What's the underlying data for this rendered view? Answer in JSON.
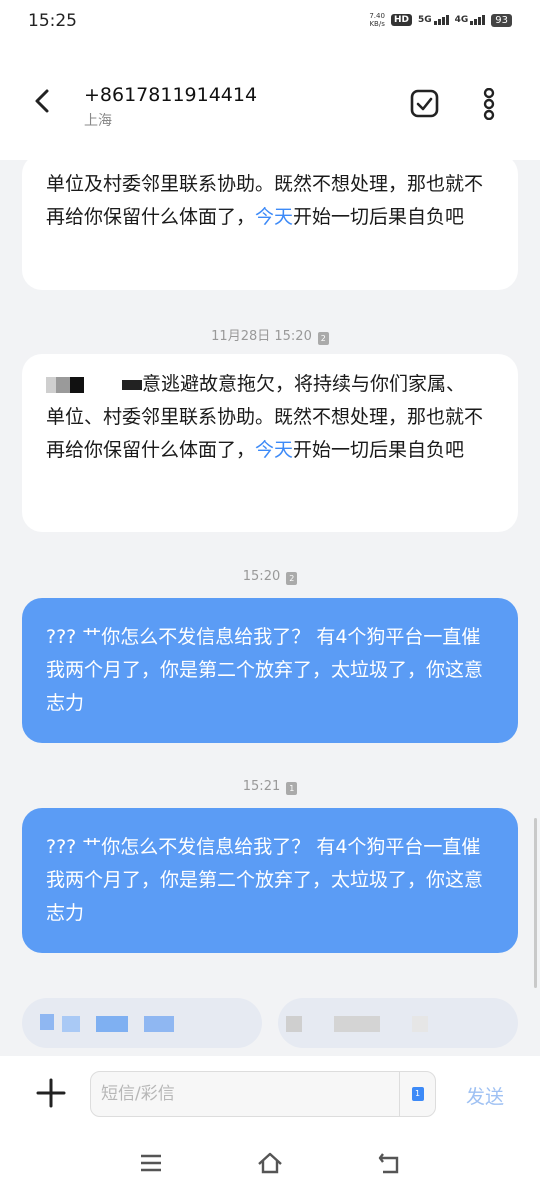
{
  "status_bar": {
    "time": "15:25",
    "speed_value": "7.40",
    "speed_unit": "KB/s",
    "hd_label": "HD",
    "network_1": "5G",
    "network_2": "4G",
    "battery": "93"
  },
  "header": {
    "contact_number": "+8617811914414",
    "contact_location": "上海"
  },
  "messages": [
    {
      "direction": "incoming",
      "text_plain": "单位及村委邻里联系协助。既然不想处理，那也就不再给你保留什么体面了，",
      "text_highlight": "今天",
      "text_after": "开始一切后果自负吧"
    },
    {
      "timestamp": "11月28日 15:20",
      "sim": "2",
      "direction": "incoming",
      "line1_visible": "意逃避故意拖欠，将持续与你们家属、",
      "text_plain": "单位、村委邻里联系协助。既然不想处理，那也就不再给你保留什么体面了，",
      "text_highlight": "今天",
      "text_after": "开始一切后果自负吧"
    },
    {
      "timestamp": "15:20",
      "sim": "2",
      "direction": "outgoing",
      "text": "???  艹你怎么不发信息给我了？ 有4个狗平台一直催我两个月了，你是第二个放弃了，太垃圾了，你这意志力"
    },
    {
      "timestamp": "15:21",
      "sim": "1",
      "direction": "outgoing",
      "text": "???  艹你怎么不发信息给我了？ 有4个狗平台一直催我两个月了，你是第二个放弃了，太垃圾了，你这意志力"
    }
  ],
  "composer": {
    "placeholder": "短信/彩信",
    "sim": "1",
    "send_label": "发送"
  },
  "colors": {
    "outgoing_bubble": "#5b9cf5",
    "incoming_bubble": "#ffffff",
    "background": "#f2f3f5",
    "link": "#3d8af7",
    "send_disabled": "#9fc1f3"
  }
}
